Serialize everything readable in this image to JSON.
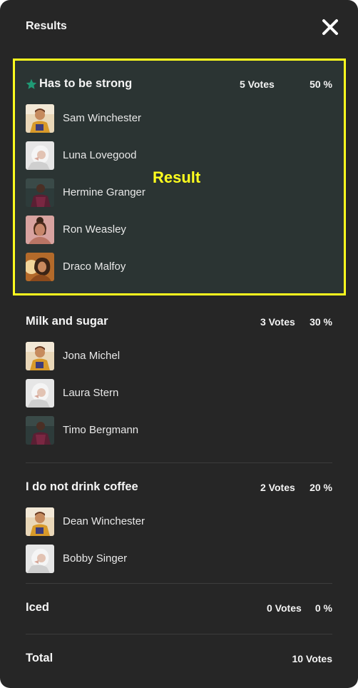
{
  "header": {
    "title": "Results",
    "close_icon": "close-icon"
  },
  "overlay": {
    "label": "Result",
    "color": "#ffff1e"
  },
  "options": [
    {
      "title": "Has to be strong",
      "votes": "5 Votes",
      "percent": "50 %",
      "winner": true,
      "icon": "star-icon",
      "voters": [
        "Sam Winchester",
        "Luna Lovegood",
        "Hermine Granger",
        "Ron Weasley",
        "Draco Malfoy"
      ]
    },
    {
      "title": "Milk and sugar",
      "votes": "3 Votes",
      "percent": "30 %",
      "voters": [
        "Jona Michel",
        "Laura Stern",
        "Timo Bergmann"
      ]
    },
    {
      "title": "I do not drink coffee",
      "votes": "2 Votes",
      "percent": "20 %",
      "voters": [
        "Dean Winchester",
        "Bobby Singer"
      ]
    },
    {
      "title": "Iced",
      "votes": "0 Votes",
      "percent": "0 %",
      "voters": []
    }
  ],
  "total": {
    "label": "Total",
    "votes": "10 Votes"
  },
  "colors": {
    "panel": "#262626",
    "winner_bg": "#2b3433",
    "star": "#1f9a75",
    "highlight": "#ffff1e"
  }
}
